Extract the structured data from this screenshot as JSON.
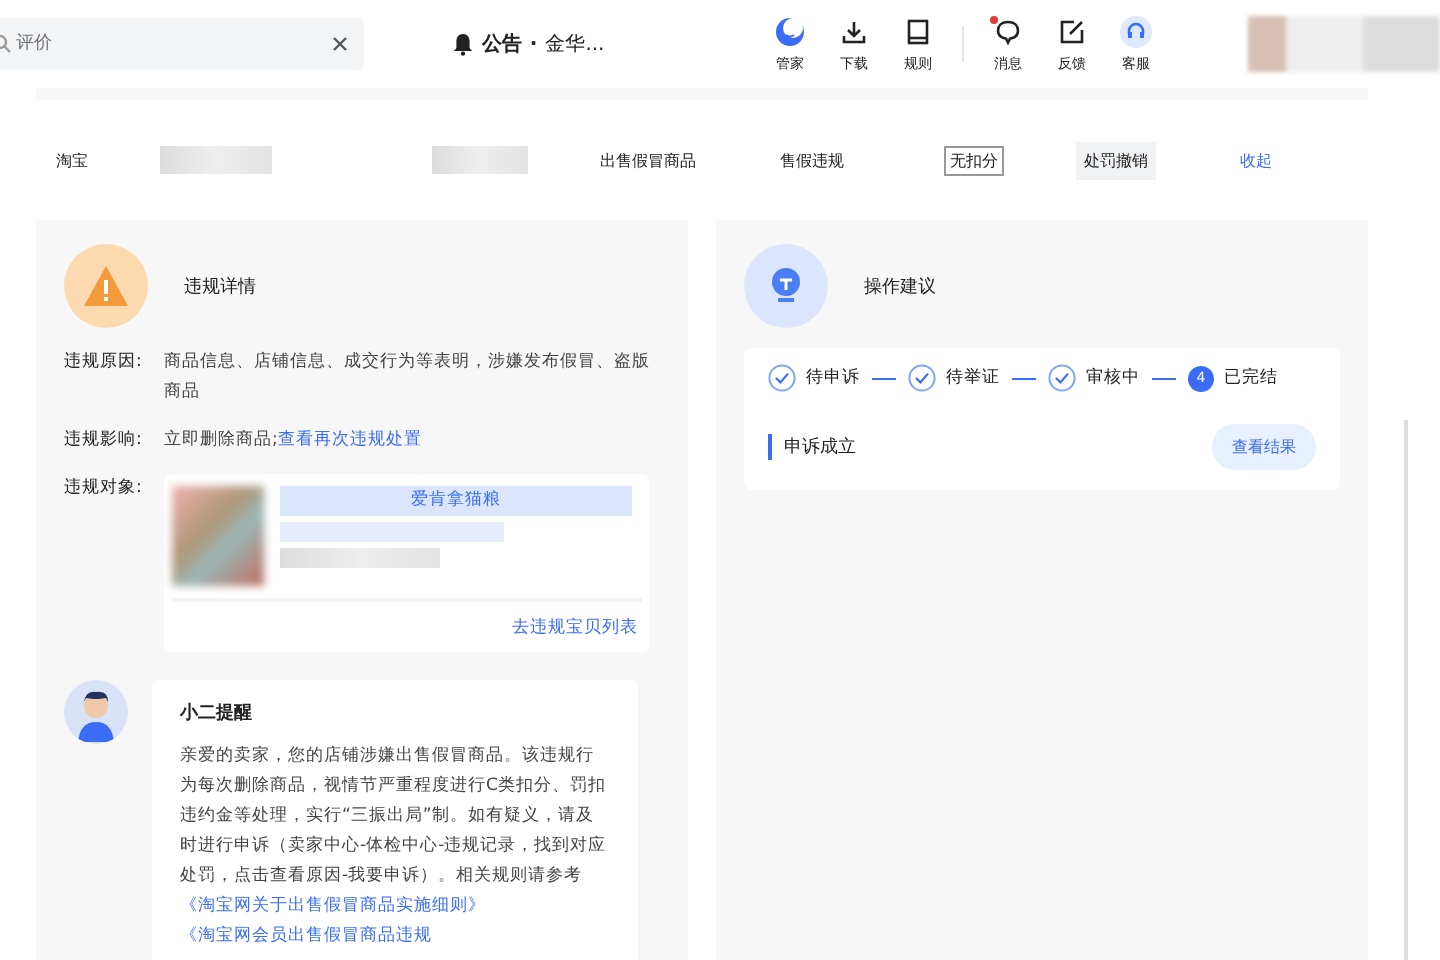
{
  "search": {
    "placeholder": "评价"
  },
  "notice": {
    "label": "公告",
    "separator": "·",
    "text": "金华..."
  },
  "toolbar": [
    {
      "label": "管家",
      "dot": false
    },
    {
      "label": "下载",
      "dot": false
    },
    {
      "label": "规则",
      "dot": false
    },
    {
      "label": "消息",
      "dot": true
    },
    {
      "label": "反馈",
      "dot": false
    },
    {
      "label": "客服",
      "dot": false
    }
  ],
  "record": {
    "platform": "淘宝",
    "type": "出售假冒商品",
    "category": "售假违规",
    "points": "无扣分",
    "status": "处罚撤销",
    "toggle": "收起"
  },
  "details": {
    "title": "违规详情",
    "rows": [
      {
        "label": "违规原因:",
        "parts": [
          {
            "text": "商品信息、店铺信息、成交行为等表明，涉嫌发布假冒、盗版商品",
            "link": false
          }
        ]
      },
      {
        "label": "违规影响:",
        "parts": [
          {
            "text": "立即删除商品;",
            "link": false
          },
          {
            "text": "查看再次违规处置",
            "link": true
          }
        ]
      }
    ],
    "target_label": "违规对象:",
    "product_name": "爱肯拿猫粮",
    "list_link": "去违规宝贝列表"
  },
  "reminder": {
    "title": "小二提醒",
    "parts": [
      {
        "text": "亲爱的卖家，您的店铺涉嫌出售假冒商品。该违规行为每次删除商品，视情节严重程度进行C类扣分、罚扣违约金等处理，实行“三振出局”制。如有疑义，请及时进行申诉（卖家中心-体检中心-违规记录，找到对应处罚，点击查看原因-我要申诉）。相关规则请参考",
        "link": false
      },
      {
        "text": "《淘宝网关于出售假冒商品实施细则》",
        "link": true
      },
      {
        "text": "《淘宝网会员出售假冒商品违规",
        "link": true
      }
    ]
  },
  "advice": {
    "title": "操作建议",
    "steps": [
      {
        "kind": "check",
        "label": "待申诉"
      },
      {
        "kind": "check",
        "label": "待举证"
      },
      {
        "kind": "check",
        "label": "审核中"
      },
      {
        "kind": "number",
        "number": "4",
        "label": "已完结"
      }
    ],
    "result": "申诉成立",
    "button": "查看结果"
  }
}
